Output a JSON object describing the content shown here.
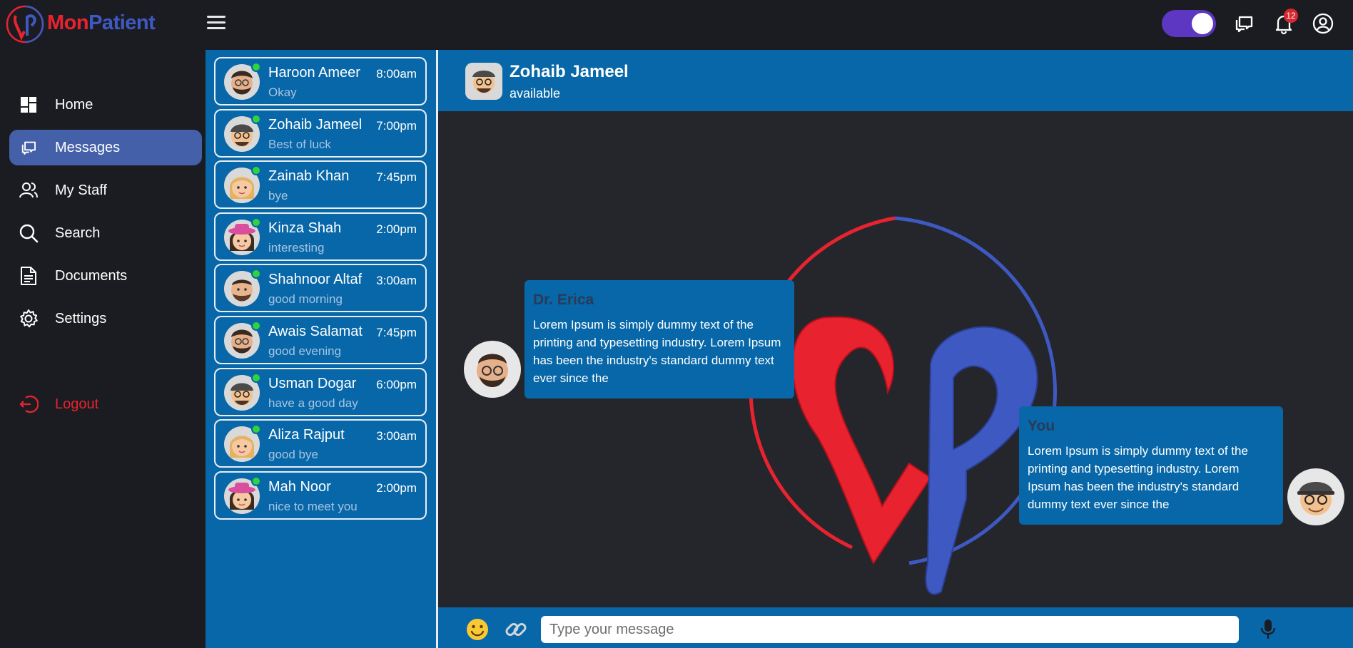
{
  "brand": {
    "part1": "Mon",
    "part2": "Patient"
  },
  "topbar": {
    "notification_count": "12",
    "toggle_on": true
  },
  "nav": [
    {
      "label": "Home",
      "icon": "dashboard-icon"
    },
    {
      "label": "Messages",
      "icon": "chat-icon"
    },
    {
      "label": "My Staff",
      "icon": "people-icon"
    },
    {
      "label": "Search",
      "icon": "search-icon"
    },
    {
      "label": "Documents",
      "icon": "document-icon"
    },
    {
      "label": "Settings",
      "icon": "gear-icon"
    },
    {
      "label": "Logout",
      "icon": "logout-icon"
    }
  ],
  "chats": [
    {
      "name": "Haroon Ameer",
      "time": "8:00am",
      "msg": "Okay"
    },
    {
      "name": "Zohaib Jameel",
      "time": "7:00pm",
      "msg": "Best of luck"
    },
    {
      "name": "Zainab Khan",
      "time": "7:45pm",
      "msg": "bye"
    },
    {
      "name": "Kinza Shah",
      "time": "2:00pm",
      "msg": "interesting"
    },
    {
      "name": "Shahnoor Altaf",
      "time": "3:00am",
      "msg": "good morning"
    },
    {
      "name": "Awais Salamat",
      "time": "7:45pm",
      "msg": "good evening"
    },
    {
      "name": "Usman Dogar",
      "time": "6:00pm",
      "msg": "have a good day"
    },
    {
      "name": "Aliza Rajput",
      "time": "3:00am",
      "msg": "good bye"
    },
    {
      "name": "Mah Noor",
      "time": "2:00pm",
      "msg": "nice to meet you"
    }
  ],
  "conversation": {
    "name": "Zohaib Jameel",
    "status": "available",
    "messages": [
      {
        "sender": "Dr. Erica",
        "text": "Lorem Ipsum is simply dummy text of the printing and typesetting industry. Lorem Ipsum has been the industry's standard dummy text ever since the"
      },
      {
        "sender": "You",
        "text": "Lorem Ipsum is simply dummy text of the printing and typesetting industry. Lorem Ipsum has been the industry's standard dummy text ever since the"
      }
    ]
  },
  "composer": {
    "placeholder": "Type your message"
  },
  "colors": {
    "brand_red": "#e8232f",
    "brand_blue": "#3f59c2",
    "panel_blue": "#0767a8",
    "active_nav": "#4360a9",
    "online": "#30d33d"
  }
}
